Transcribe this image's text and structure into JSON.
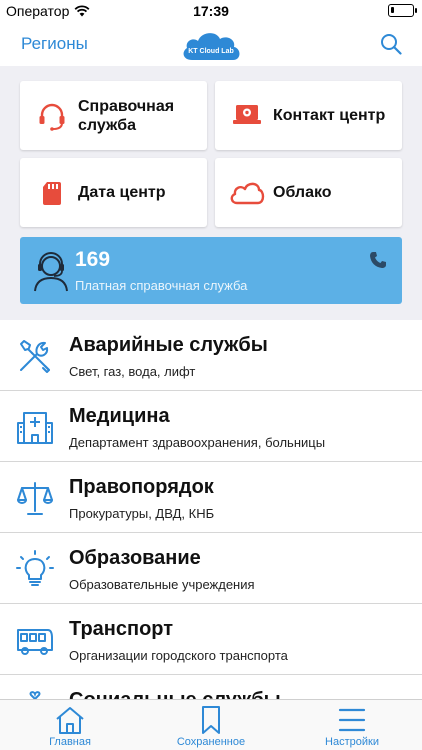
{
  "status_bar": {
    "carrier": "Оператор",
    "time": "17:39",
    "battery_level": 0.15
  },
  "navbar": {
    "regions_label": "Регионы",
    "logo_text": "KT Cloud Lab"
  },
  "tiles": [
    {
      "label": "Справочная служба",
      "icon": "headset-icon",
      "color": "#e74c3c"
    },
    {
      "label": "Контакт центр",
      "icon": "laptop-icon",
      "color": "#e74c3c"
    },
    {
      "label": "Дата центр",
      "icon": "sd-card-icon",
      "color": "#e74c3c"
    },
    {
      "label": "Облако",
      "icon": "cloud-icon",
      "color": "#e74c3c"
    }
  ],
  "paid_service": {
    "number": "169",
    "label": "Платная справочная служба",
    "bg_color": "#5cb0e6"
  },
  "list": [
    {
      "title": "Аварийные службы",
      "subtitle": "Свет, газ, вода, лифт",
      "icon": "tools-icon"
    },
    {
      "title": "Медицина",
      "subtitle": "Департамент здравоохранения, больницы",
      "icon": "hospital-icon"
    },
    {
      "title": "Правопорядок",
      "subtitle": "Прокуратуры, ДВД, КНБ",
      "icon": "scales-icon"
    },
    {
      "title": "Образование",
      "subtitle": "Образовательные учреждения",
      "icon": "lightbulb-icon"
    },
    {
      "title": "Транспорт",
      "subtitle": "Организации городского транспорта",
      "icon": "bus-icon"
    },
    {
      "title": "Социальные службы",
      "subtitle": "",
      "icon": "social-icon"
    }
  ],
  "tabbar": [
    {
      "label": "Главная",
      "icon": "home-icon"
    },
    {
      "label": "Сохраненное",
      "icon": "bookmark-icon"
    },
    {
      "label": "Настройки",
      "icon": "menu-icon"
    }
  ],
  "colors": {
    "accent": "#2e89d6",
    "icon_red": "#e74c3c",
    "list_icon": "#2e89d6"
  }
}
